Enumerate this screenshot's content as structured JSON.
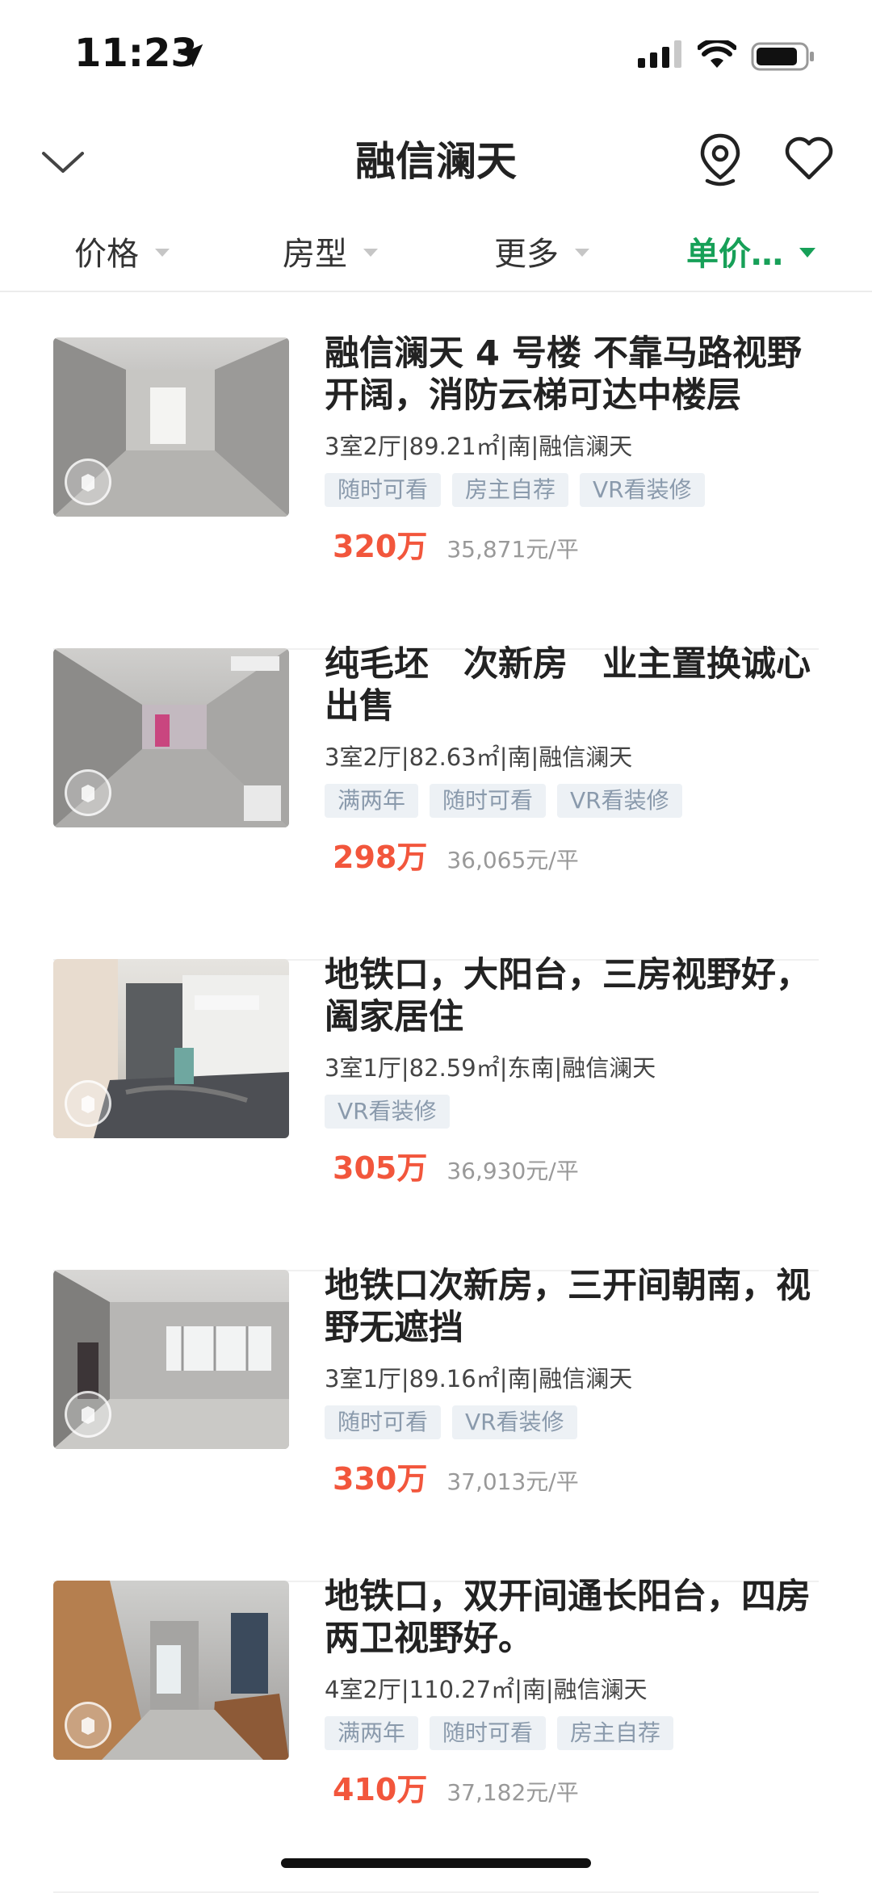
{
  "status": {
    "time": "11:23"
  },
  "nav": {
    "title": "融信澜天"
  },
  "filters": [
    {
      "label": "价格",
      "active": false
    },
    {
      "label": "房型",
      "active": false
    },
    {
      "label": "更多",
      "active": false
    },
    {
      "label": "单价…",
      "active": true
    }
  ],
  "listings": [
    {
      "title": "融信澜天 4 号楼 不靠马路视野开阔，消防云梯可达中楼层",
      "meta": "3室2厅|89.21㎡|南|融信澜天",
      "tags": [
        "随时可看",
        "房主自荐",
        "VR看装修"
      ],
      "price": "320万",
      "unit_price": "35,871元/平"
    },
    {
      "title": "纯毛坯　次新房　业主置换诚心出售",
      "meta": "3室2厅|82.63㎡|南|融信澜天",
      "tags": [
        "满两年",
        "随时可看",
        "VR看装修"
      ],
      "price": "298万",
      "unit_price": "36,065元/平"
    },
    {
      "title": "地铁口，大阳台，三房视野好，阖家居住",
      "meta": "3室1厅|82.59㎡|东南|融信澜天",
      "tags": [
        "VR看装修"
      ],
      "price": "305万",
      "unit_price": "36,930元/平"
    },
    {
      "title": "地铁口次新房，三开间朝南，视野无遮挡",
      "meta": "3室1厅|89.16㎡|南|融信澜天",
      "tags": [
        "随时可看",
        "VR看装修"
      ],
      "price": "330万",
      "unit_price": "37,013元/平"
    },
    {
      "title": "地铁口，双开间通长阳台，四房两卫视野好。",
      "meta": "4室2厅|110.27㎡|南|融信澜天",
      "tags": [
        "满两年",
        "随时可看",
        "房主自荐"
      ],
      "price": "410万",
      "unit_price": "37,182元/平"
    }
  ],
  "icons": {
    "back": "chevron-down-icon",
    "map": "map-pin-icon",
    "favorite": "heart-icon",
    "vr": "vr-panorama-icon"
  },
  "colors": {
    "accent": "#17a058",
    "price": "#f2563c",
    "tag_bg": "#edf1f5",
    "tag_text": "#8a9aac"
  }
}
